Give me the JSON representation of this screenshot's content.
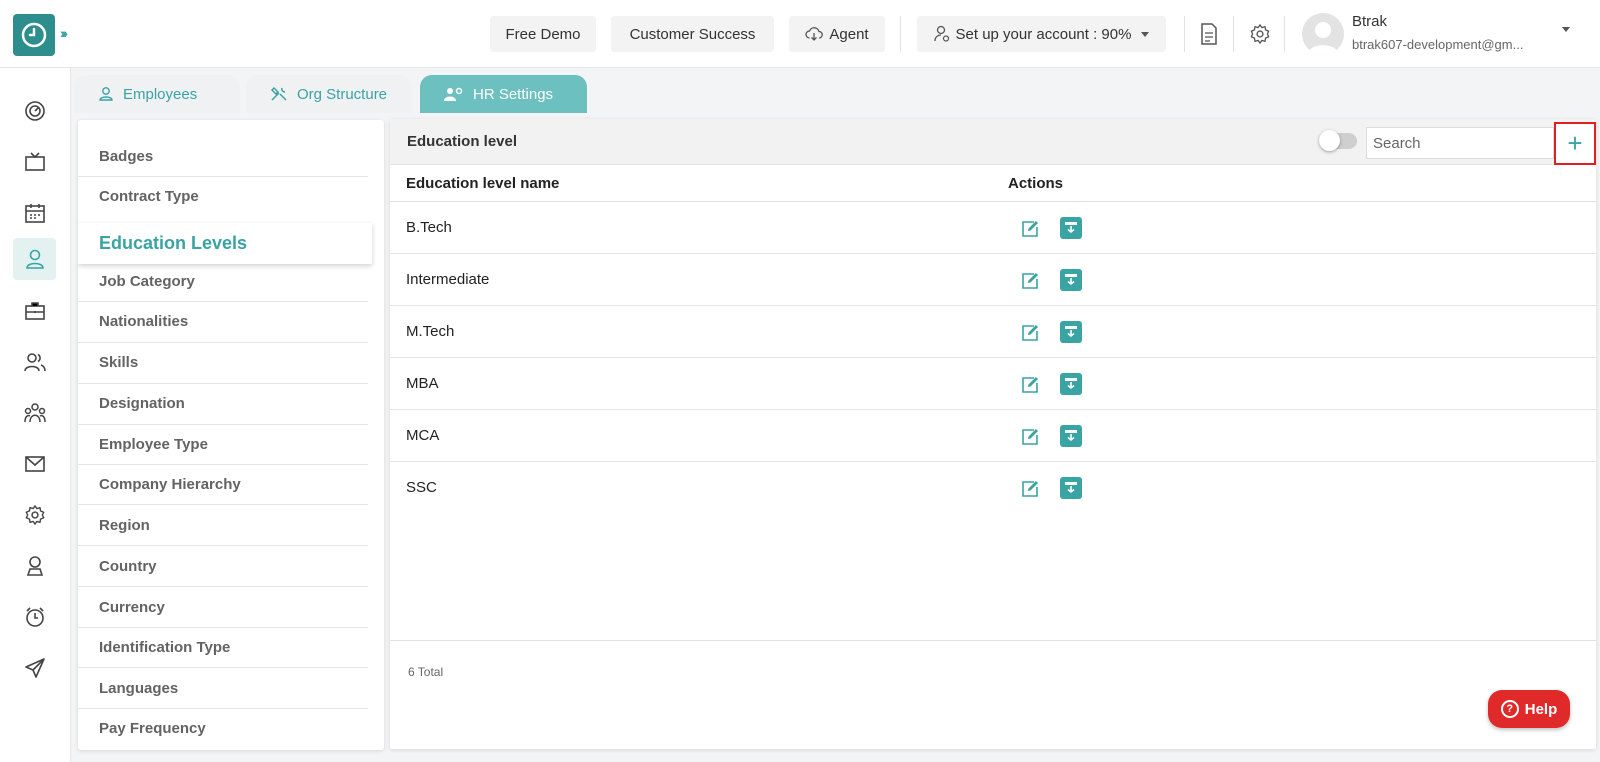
{
  "colors": {
    "accent": "#3aa3a3",
    "active_tab": "#6cc0c0",
    "help": "#e02a2a",
    "highlight": "#e02020"
  },
  "topbar": {
    "free_demo": "Free Demo",
    "customer_success": "Customer Success",
    "agent": "Agent",
    "setup": "Set up your account : 90%",
    "user_name": "Btrak",
    "user_email": "btrak607-development@gm..."
  },
  "tabs": [
    {
      "label": "Employees",
      "icon": "person-icon"
    },
    {
      "label": "Org Structure",
      "icon": "tools-icon"
    },
    {
      "label": "HR Settings",
      "icon": "people-gear-icon"
    }
  ],
  "settings_menu": [
    "Badges",
    "Contract Type",
    "Education Levels",
    "Job Category",
    "Nationalities",
    "Skills",
    "Designation",
    "Employee Type",
    "Company Hierarchy",
    "Region",
    "Country",
    "Currency",
    "Identification Type",
    "Languages",
    "Pay Frequency"
  ],
  "panel": {
    "title": "Education level",
    "search_placeholder": "Search",
    "add_label": "+",
    "columns": {
      "name": "Education level name",
      "actions": "Actions"
    },
    "rows": [
      "B.Tech",
      "Intermediate",
      "M.Tech",
      "MBA",
      "MCA",
      "SSC"
    ],
    "total": "6 Total"
  },
  "help": {
    "label": "Help"
  }
}
